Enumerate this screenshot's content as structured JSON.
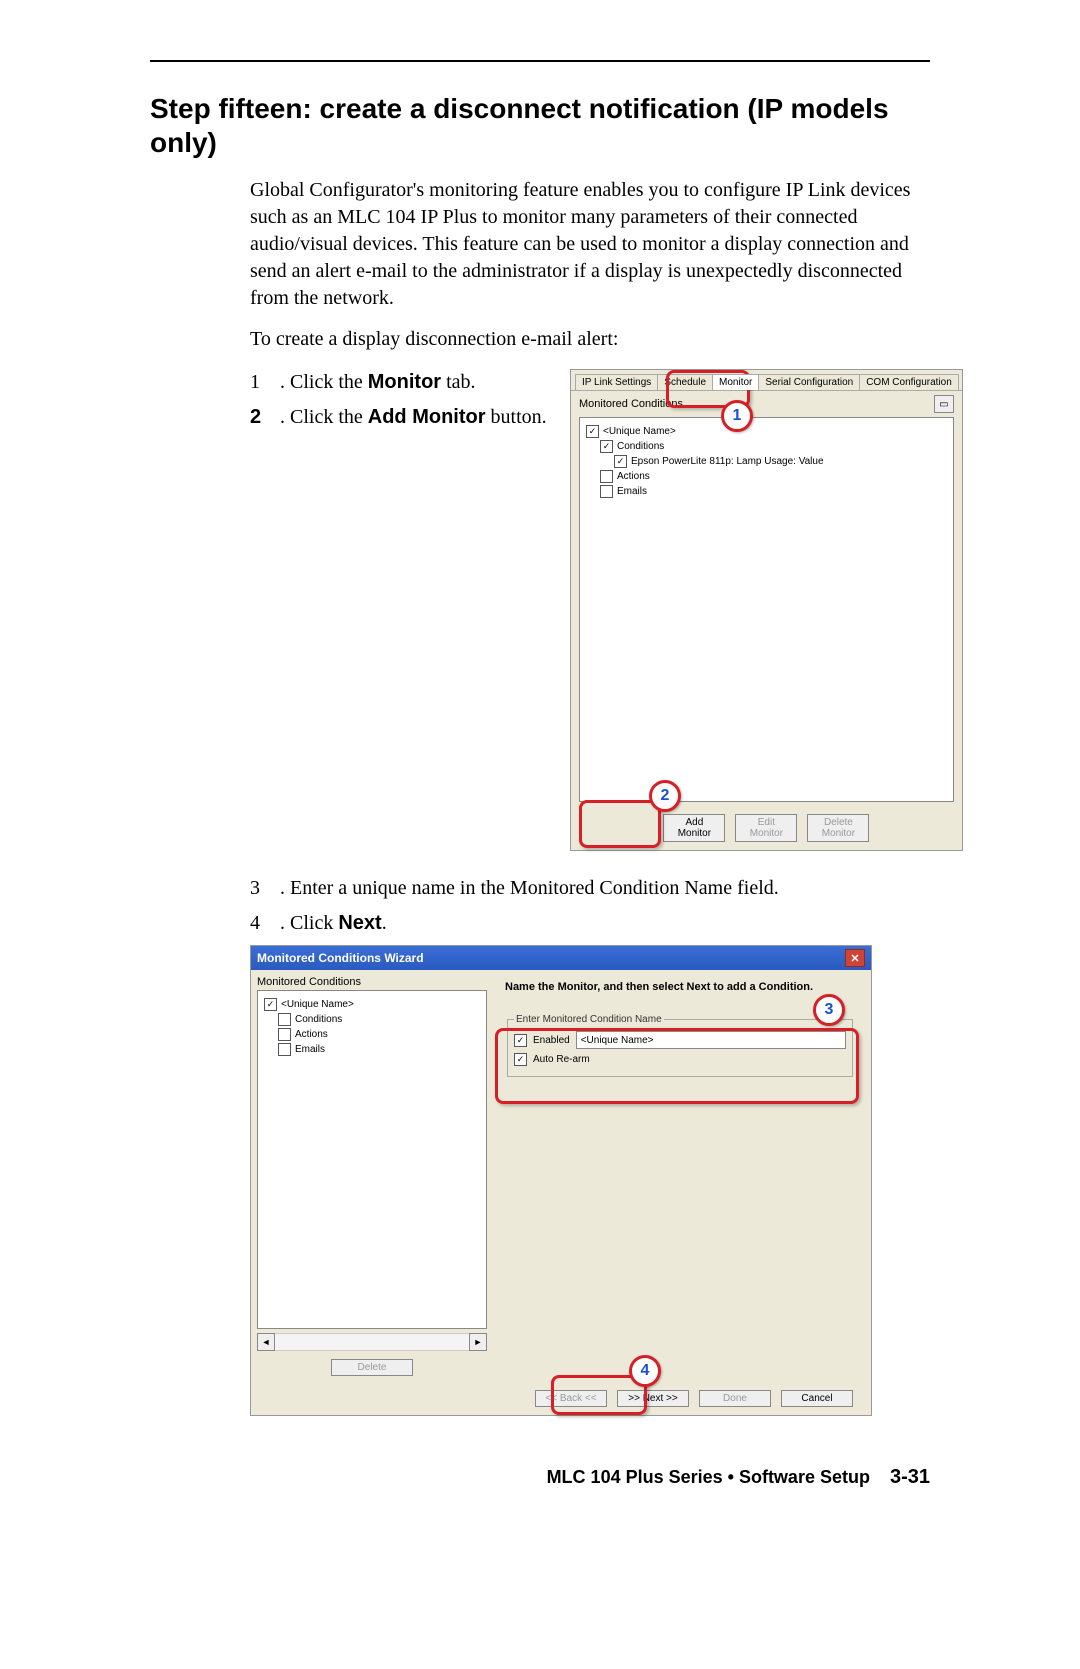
{
  "heading": "Step fifteen: create a disconnect notification (IP models only)",
  "intro1": "Global Configurator's monitoring feature enables you to configure IP Link devices such as an MLC 104 IP Plus to monitor many parameters of their connected audio/visual devices.  This feature can be used to monitor a display connection and send an alert e-mail to the administrator if a display is unexpectedly disconnected from the network.",
  "intro2": "To create a display disconnection e-mail alert:",
  "steps": {
    "s1num": "1",
    "s1a": ". Click the ",
    "s1b": "Monitor",
    "s1c": " tab.",
    "s2num": "2",
    "s2a": ". Click the ",
    "s2b": "Add Monitor",
    "s2c": " button.",
    "s3num": "3",
    "s3a": ". Enter a unique name in the Monitored Condition Name field.",
    "s4num": "4",
    "s4a": ". Click ",
    "s4b": "Next",
    "s4c": "."
  },
  "shot1": {
    "tabs": {
      "t1": "IP Link Settings",
      "t2": "Schedule",
      "t3": "Monitor",
      "t4": "Serial Configuration",
      "t5": "COM Configuration"
    },
    "mc_label": "Monitored Conditions",
    "tree": {
      "n1": "<Unique Name>",
      "n2": "Conditions",
      "n3": "Epson PowerLite 811p: Lamp Usage: Value",
      "n4": "Actions",
      "n5": "Emails"
    },
    "btns": {
      "add": "Add\nMonitor",
      "edit": "Edit\nMonitor",
      "del": "Delete\nMonitor"
    }
  },
  "shot2": {
    "title": "Monitored Conditions Wizard",
    "left_label": "Monitored Conditions",
    "tree": {
      "n1": "<Unique Name>",
      "n2": "Conditions",
      "n3": "Actions",
      "n4": "Emails"
    },
    "hdr": "Name the Monitor, and then select Next to add a Condition.",
    "legend": "Enter Monitored Condition Name",
    "enabled": "Enabled",
    "autorearm": "Auto Re-arm",
    "name_value": "<Unique Name>",
    "delete": "Delete",
    "back": "<< Back <<",
    "next": ">> Next >>",
    "done": "Done",
    "cancel": "Cancel"
  },
  "callouts": {
    "c1": "1",
    "c2": "2",
    "c3": "3",
    "c4": "4"
  },
  "footer": {
    "title": "MLC 104 Plus Series • Software Setup",
    "page": "3-31"
  }
}
